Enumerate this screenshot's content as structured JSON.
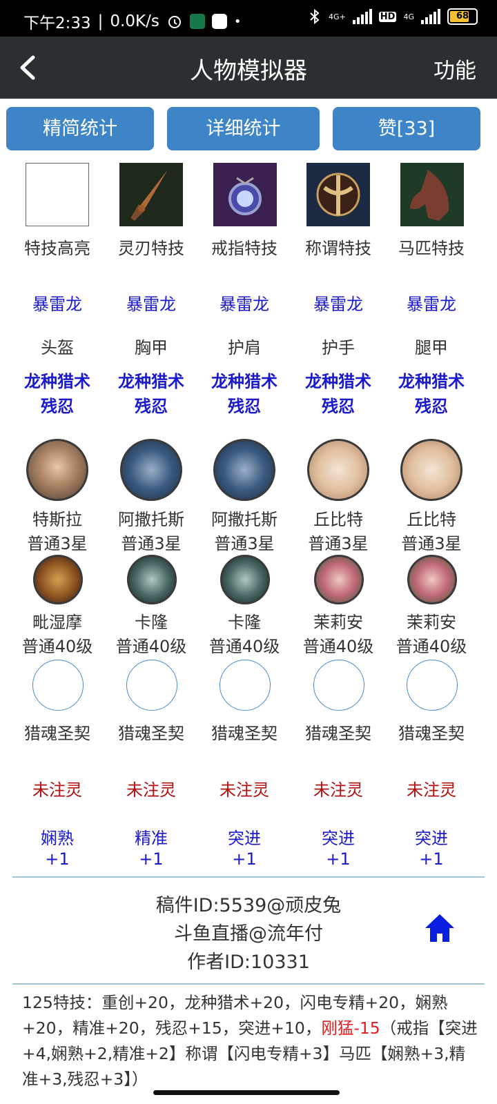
{
  "status_bar": {
    "time": "下午2:33",
    "speed": "0.0K/s",
    "net1": "4G+",
    "hd": "HD",
    "net2": "4G",
    "battery": "68"
  },
  "header": {
    "title": "人物模拟器",
    "func": "功能"
  },
  "tabs": [
    "精简统计",
    "详细统计",
    "赞[33]"
  ],
  "equipment": [
    {
      "icon": "blank-slot",
      "label": "特技高亮"
    },
    {
      "icon": "dagger-icon",
      "label": "灵刃特技"
    },
    {
      "icon": "ring-icon",
      "label": "戒指特技"
    },
    {
      "icon": "emblem-icon",
      "label": "称谓特技"
    },
    {
      "icon": "horse-icon",
      "label": "马匹特技"
    }
  ],
  "set_name": [
    "暴雷龙",
    "暴雷龙",
    "暴雷龙",
    "暴雷龙",
    "暴雷龙"
  ],
  "armor": [
    {
      "part": "头盔",
      "line1": "龙种猎术",
      "line2": "残忍"
    },
    {
      "part": "胸甲",
      "line1": "龙种猎术",
      "line2": "残忍"
    },
    {
      "part": "护肩",
      "line1": "龙种猎术",
      "line2": "残忍"
    },
    {
      "part": "护手",
      "line1": "龙种猎术",
      "line2": "残忍"
    },
    {
      "part": "腿甲",
      "line1": "龙种猎术",
      "line2": "残忍"
    }
  ],
  "heroes_big": [
    {
      "name": "特斯拉",
      "level": "普通3星"
    },
    {
      "name": "阿撒托斯",
      "level": "普通3星"
    },
    {
      "name": "阿撒托斯",
      "level": "普通3星"
    },
    {
      "name": "丘比特",
      "level": "普通3星"
    },
    {
      "name": "丘比特",
      "level": "普通3星"
    }
  ],
  "heroes_small": [
    {
      "name": "毗湿摩",
      "level": "普通40级"
    },
    {
      "name": "卡隆",
      "level": "普通40级"
    },
    {
      "name": "卡隆",
      "level": "普通40级"
    },
    {
      "name": "茉莉安",
      "level": "普通40级"
    },
    {
      "name": "茉莉安",
      "level": "普通40级"
    }
  ],
  "contracts": [
    "猎魂圣契",
    "猎魂圣契",
    "猎魂圣契",
    "猎魂圣契",
    "猎魂圣契"
  ],
  "spirit": [
    "未注灵",
    "未注灵",
    "未注灵",
    "未注灵",
    "未注灵"
  ],
  "skills": [
    {
      "name": "娴熟",
      "val": "+1"
    },
    {
      "name": "精准",
      "val": "+1"
    },
    {
      "name": "突进",
      "val": "+1"
    },
    {
      "name": "突进",
      "val": "+1"
    },
    {
      "name": "突进",
      "val": "+1"
    }
  ],
  "info": {
    "line1": "稿件ID:5539@顽皮兔",
    "line2": "斗鱼直播@流年付",
    "line3": "作者ID:10331"
  },
  "summary": {
    "part1": "125特技：重创+20，龙种猎术+20，闪电专精+20，娴熟+20，精准+20，残忍+15，突进+10，",
    "red": "刚猛-15",
    "part2": "（戒指【突进+4,娴熟+2,精准+2】称谓【闪电专精+3】马匹【娴熟+3,精准+3,残忍+3】）"
  },
  "colors": {
    "accent": "#3d85c6",
    "header_bg": "#2a2f31",
    "blue_text": "#1a1acc",
    "red_text": "#b01010",
    "home": "#0a1ee0"
  }
}
